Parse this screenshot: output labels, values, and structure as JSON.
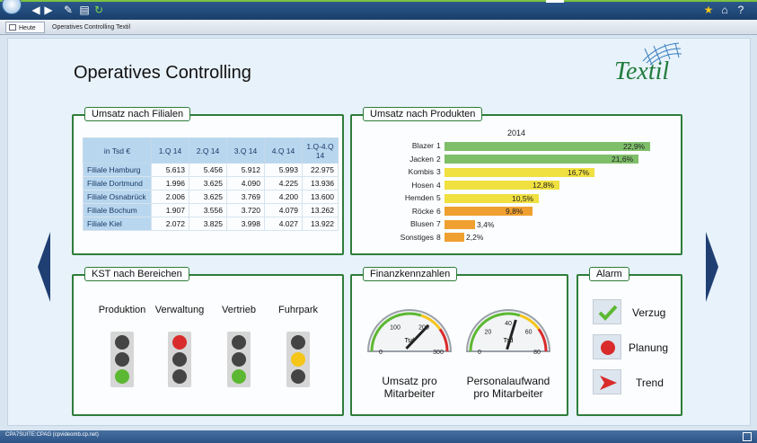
{
  "app": {
    "tabs": {
      "home": "Heute",
      "current": "Operatives Controlling Textil"
    },
    "status": "CPA7SUITE:CPAG (cpvideomb.cp.net)"
  },
  "page": {
    "title": "Operatives Controlling",
    "logo": "Textil"
  },
  "filialen": {
    "title": "Umsatz nach Filialen",
    "headers": [
      "in Tsd €",
      "1.Q 14",
      "2.Q 14",
      "3.Q 14",
      "4.Q 14",
      "1.Q-4.Q 14"
    ],
    "rows": [
      {
        "name": "Filiale Hamburg",
        "values": [
          "5.613",
          "5.456",
          "5.912",
          "5.993",
          "22.975"
        ]
      },
      {
        "name": "Filiale Dortmund",
        "values": [
          "1.996",
          "3.625",
          "4.090",
          "4.225",
          "13.936"
        ]
      },
      {
        "name": "Filiale Osnabrück",
        "values": [
          "2.006",
          "3.625",
          "3.769",
          "4.200",
          "13.600"
        ]
      },
      {
        "name": "Filiale Bochum",
        "values": [
          "1.907",
          "3.556",
          "3.720",
          "4.079",
          "13.262"
        ]
      },
      {
        "name": "Filiale Kiel",
        "values": [
          "2.072",
          "3.825",
          "3.998",
          "4.027",
          "13.922"
        ]
      }
    ]
  },
  "chart_data": {
    "type": "bar",
    "orientation": "horizontal",
    "title": "Umsatz nach Produkten",
    "subtitle": "2014",
    "categories": [
      "Blazer",
      "Jacken",
      "Kombis",
      "Hosen",
      "Hemden",
      "Röcke",
      "Blusen",
      "Sonstiges"
    ],
    "ranks": [
      "1",
      "2",
      "3",
      "4",
      "5",
      "6",
      "7",
      "8"
    ],
    "values": [
      22.9,
      21.6,
      16.7,
      12.8,
      10.5,
      9.8,
      3.4,
      2.2
    ],
    "labels": [
      "22,9%",
      "21,6%",
      "16,7%",
      "12,8%",
      "10,5%",
      "9,8%",
      "3,4%",
      "2,2%"
    ],
    "colors": [
      "#7fbf6a",
      "#7fbf6a",
      "#f0e040",
      "#f0e040",
      "#f0e040",
      "#f0a030",
      "#f0a030",
      "#f0a030"
    ],
    "xlim": [
      0,
      23
    ]
  },
  "kst": {
    "title": "KST nach Bereichen",
    "areas": [
      {
        "label": "Produktion",
        "lamps": [
          "#444",
          "#444",
          "#5cb832"
        ]
      },
      {
        "label": "Verwaltung",
        "lamps": [
          "#d92b2b",
          "#444",
          "#444"
        ]
      },
      {
        "label": "Vertrieb",
        "lamps": [
          "#444",
          "#444",
          "#5cb832"
        ]
      },
      {
        "label": "Fuhrpark",
        "lamps": [
          "#444",
          "#f5c518",
          "#444"
        ]
      }
    ]
  },
  "finanz": {
    "title": "Finanzkennzahlen",
    "gauges": [
      {
        "caption_1": "Umsatz pro",
        "caption_2": "Mitarbeiter",
        "unit": "Tsd",
        "ticks": [
          "0",
          "100",
          "200",
          "300"
        ],
        "max": 300,
        "value": 210
      },
      {
        "caption_1": "Personalaufwand",
        "caption_2": "pro Mitarbeiter",
        "unit": "Tsd",
        "ticks": [
          "0",
          "20",
          "40",
          "60",
          "80"
        ],
        "max": 80,
        "value": 46
      }
    ]
  },
  "alarm": {
    "title": "Alarm",
    "items": [
      {
        "label": "Verzug",
        "icon": "check-icon"
      },
      {
        "label": "Planung",
        "icon": "red-dot-icon"
      },
      {
        "label": "Trend",
        "icon": "arrow-icon"
      }
    ]
  }
}
